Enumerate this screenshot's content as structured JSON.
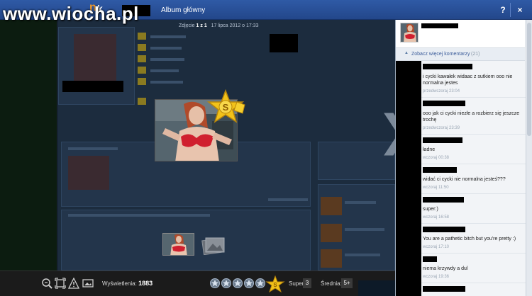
{
  "watermark": "www.wiocha.pl",
  "header": {
    "logo_n": "n",
    "logo_k": "k",
    "album_title": "Album główny",
    "help_label": "?",
    "close_label": "×"
  },
  "photo": {
    "prefix": "Zdjęcie",
    "index": "1 z 1",
    "date": "17 lipca 2012 o 17:33"
  },
  "toolbar": {
    "views_label": "Wyświetlenia:",
    "views_value": "1883",
    "rating_label": "Super",
    "rating_count": "3",
    "avg_label": "Średnia:",
    "avg_value": "5+",
    "tools": [
      "zoom-icon",
      "fullscreen-icon",
      "report-icon",
      "set-avatar-icon"
    ]
  },
  "comments_panel": {
    "more_label": "Zobacz więcej komentarzy",
    "more_count": "(21)",
    "comments": [
      {
        "text": "i cycki kawałek widaac z sutkiem ooo nie normalna jestes",
        "time": "przedwczoraj 23:04"
      },
      {
        "text": "ooo jak ci cycki niezłe a rozbierz się jeszcze trochę",
        "time": "przedwczoraj 23:39"
      },
      {
        "text": "ładne",
        "time": "wczoraj 00:38"
      },
      {
        "text": "widać ci cycki nie normalna jesteś???",
        "time": "wczoraj 11:50"
      },
      {
        "text": "super:)",
        "time": "wczoraj 16:58"
      },
      {
        "text": "You are a pathetic bitch but you're pretty :)",
        "time": "wczoraj 17:10"
      },
      {
        "text": "niema krzywdy a dul",
        "time": "wczoraj 19:36"
      }
    ]
  },
  "colors": {
    "titlebar": "#2f5aa6",
    "logo_accent": "#f39a2a",
    "link": "#3b5c9a",
    "star_gold": "#f2c21a"
  }
}
